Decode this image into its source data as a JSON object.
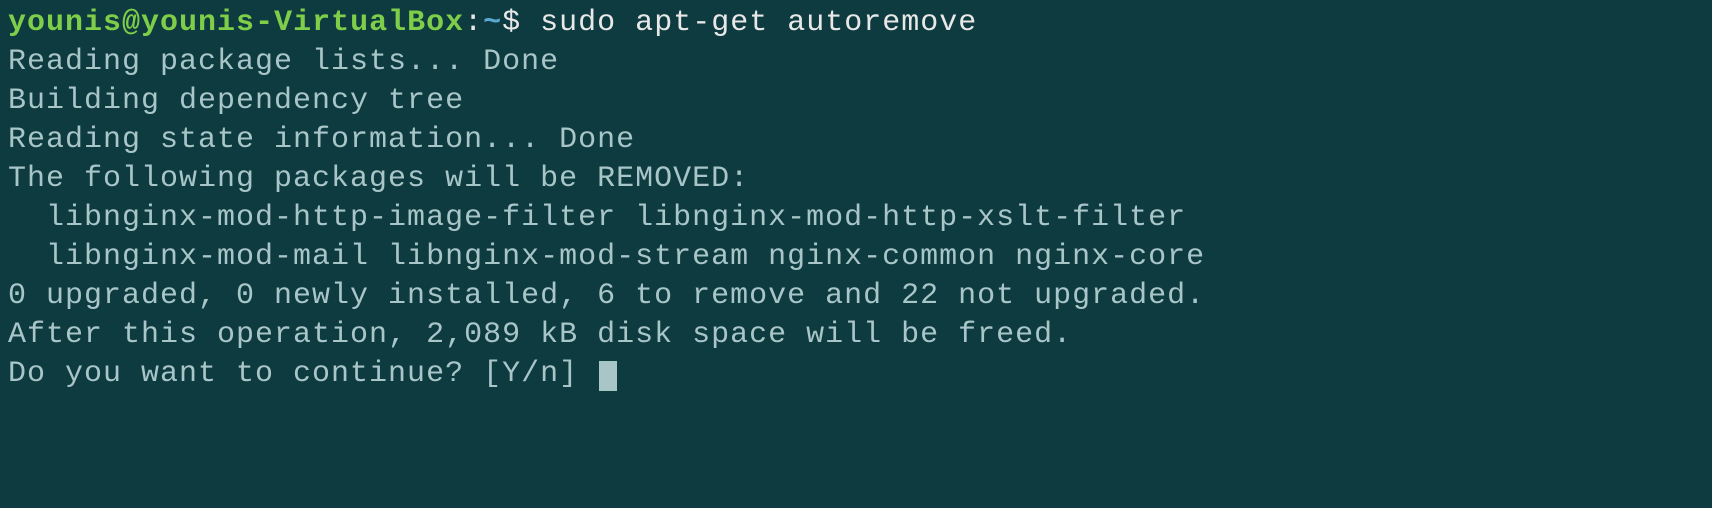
{
  "prompt": {
    "user": "younis",
    "at": "@",
    "host": "younis-VirtualBox",
    "colon": ":",
    "path": "~",
    "dollar": "$",
    "command": "sudo apt-get autoremove"
  },
  "output": {
    "line1": "Reading package lists... Done",
    "line2": "Building dependency tree",
    "line3": "Reading state information... Done",
    "line4": "The following packages will be REMOVED:",
    "line5": "  libnginx-mod-http-image-filter libnginx-mod-http-xslt-filter",
    "line6": "  libnginx-mod-mail libnginx-mod-stream nginx-common nginx-core",
    "line7": "0 upgraded, 0 newly installed, 6 to remove and 22 not upgraded.",
    "line8": "After this operation, 2,089 kB disk space will be freed.",
    "line9": "Do you want to continue? [Y/n] "
  }
}
